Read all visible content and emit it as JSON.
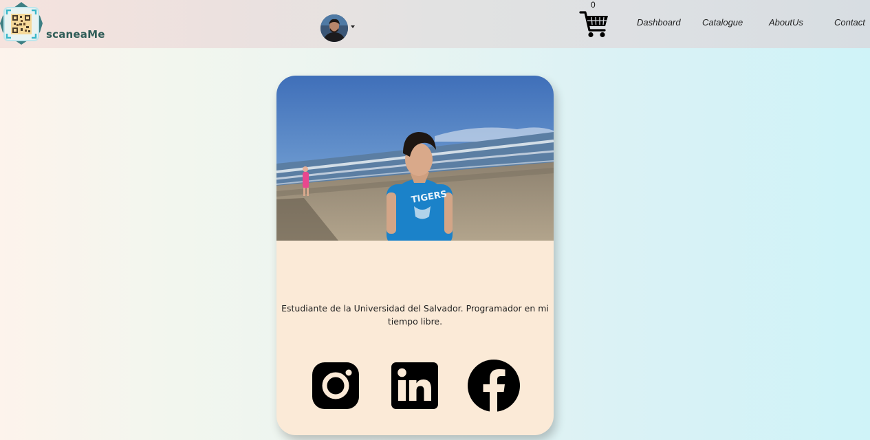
{
  "brand": {
    "name": "scaneaMe",
    "logo_icon": "qr-code-icon",
    "color": "#2f5c57"
  },
  "header": {
    "user_avatar_icon": "user-avatar",
    "dropdown_icon": "caret-down-icon",
    "cart": {
      "count": "0",
      "icon": "shopping-cart-icon"
    },
    "nav": {
      "dashboard": "Dashboard",
      "catalogue": "Catalogue",
      "aboutus": "AboutUs",
      "contact": "Contact"
    }
  },
  "profile_card": {
    "photo_icon": "profile-photo",
    "bio": "Estudiante de la Universidad del Salvador. Programador en mi tiempo libre.",
    "shirt_text": "TIGERS",
    "socials": [
      {
        "name": "Instagram",
        "icon": "instagram-icon"
      },
      {
        "name": "LinkedIn",
        "icon": "linkedin-icon"
      },
      {
        "name": "Facebook",
        "icon": "facebook-icon"
      }
    ],
    "card_color": "#fbead7"
  }
}
